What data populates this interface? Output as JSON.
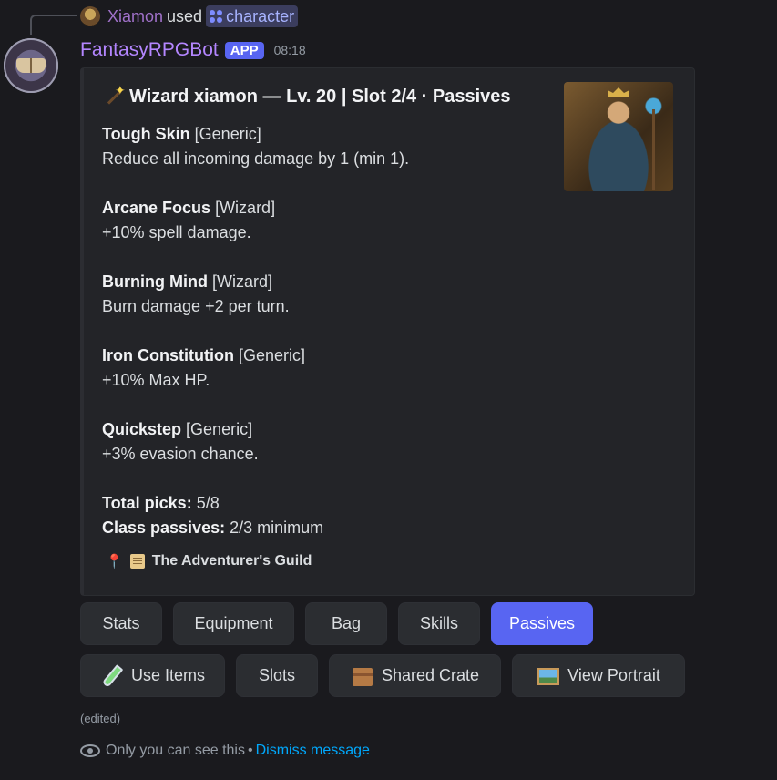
{
  "reply": {
    "user": "Xiamon",
    "used": "used",
    "command": "character"
  },
  "message": {
    "bot_name": "FantasyRPGBot",
    "badge": "APP",
    "time": "08:18"
  },
  "embed": {
    "title": "Wizard xiamon — Lv. 20 | Slot 2/4 · Passives",
    "passives": [
      {
        "name": "Tough Skin",
        "tag": "[Generic]",
        "desc": "Reduce all incoming damage by 1 (min 1)."
      },
      {
        "name": "Arcane Focus",
        "tag": "[Wizard]",
        "desc": "+10% spell damage."
      },
      {
        "name": "Burning Mind",
        "tag": "[Wizard]",
        "desc": "Burn damage +2 per turn."
      },
      {
        "name": "Iron Constitution",
        "tag": "[Generic]",
        "desc": "+10% Max HP."
      },
      {
        "name": "Quickstep",
        "tag": "[Generic]",
        "desc": "+3% evasion chance."
      }
    ],
    "total_picks_label": "Total picks:",
    "total_picks_value": "5/8",
    "class_passives_label": "Class passives:",
    "class_passives_value": "2/3 minimum",
    "footer": "The Adventurer's Guild"
  },
  "buttons_row1": [
    {
      "label": "Stats"
    },
    {
      "label": "Equipment"
    },
    {
      "label": "Bag"
    },
    {
      "label": "Skills"
    },
    {
      "label": "Passives",
      "active": true
    }
  ],
  "buttons_row2": [
    {
      "label": "Use Items",
      "icon": "test-tube-icon"
    },
    {
      "label": "Slots"
    },
    {
      "label": "Shared Crate",
      "icon": "package-icon"
    },
    {
      "label": "View Portrait",
      "icon": "framed-picture-icon"
    }
  ],
  "edited": "(edited)",
  "ephemeral": {
    "text": "Only you can see this",
    "separator": "•",
    "dismiss": "Dismiss message"
  },
  "colors": {
    "background": "#1a1a1e",
    "embed_bg": "#232428",
    "primary_button": "#5865f2",
    "bot_name": "#b486ff",
    "link": "#00a8fc"
  }
}
